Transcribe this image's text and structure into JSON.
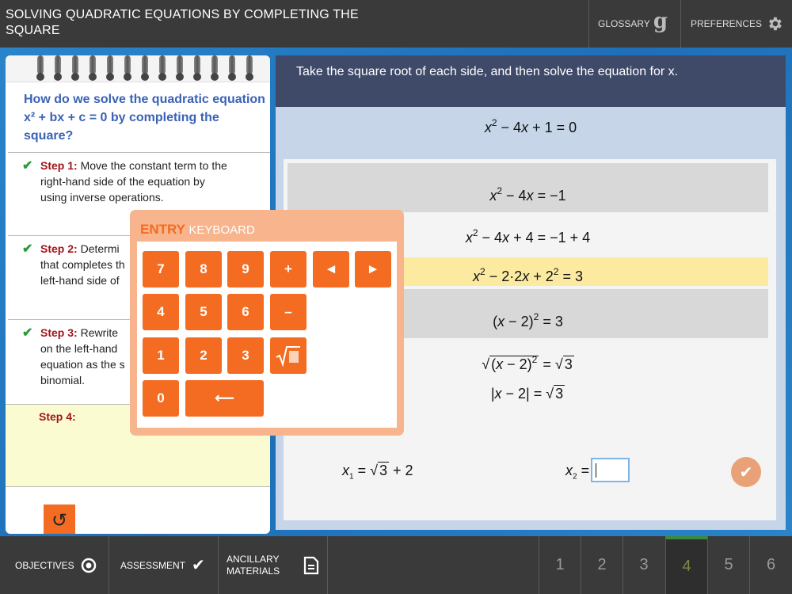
{
  "header": {
    "title": "SOLVING QUADRATIC EQUATIONS BY COMPLETING THE SQUARE",
    "glossary_label": "GLOSSARY",
    "preferences_label": "PREFERENCES"
  },
  "notebook": {
    "question": "How do we solve the quadratic equation x² + bx + c = 0 by completing the square?",
    "steps": [
      {
        "label": "Step 1:",
        "text": "Move the constant term to the right-hand side of the equation by using inverse operations."
      },
      {
        "label": "Step 2:",
        "text": "Determi that completes th left-hand side of"
      },
      {
        "label": "Step 3:",
        "text": "Rewrite on the left-hand equation as the s binomial."
      }
    ],
    "step4_label": "Step 4:"
  },
  "instruction": "Take the square root of each side, and then solve the equation for x.",
  "keyboard": {
    "title_bold": "ENTRY",
    "title_light": "KEYBOARD",
    "keys": [
      "7",
      "8",
      "9",
      "+",
      "◄",
      "►",
      "4",
      "5",
      "6",
      "–",
      "1",
      "2",
      "3",
      "0",
      "⟵"
    ]
  },
  "bottom": {
    "objectives": "OBJECTIVES",
    "assessment": "ASSESSMENT",
    "ancillary_line1": "ANCILLARY",
    "ancillary_line2": "MATERIALS",
    "pages": [
      "1",
      "2",
      "3",
      "4",
      "5",
      "6"
    ],
    "active_page": "4"
  },
  "colors": {
    "accent": "#f36c21",
    "question_blue": "#3a62b5",
    "step_red": "#a2141a",
    "highlight_yellow": "#fbeaa0"
  }
}
